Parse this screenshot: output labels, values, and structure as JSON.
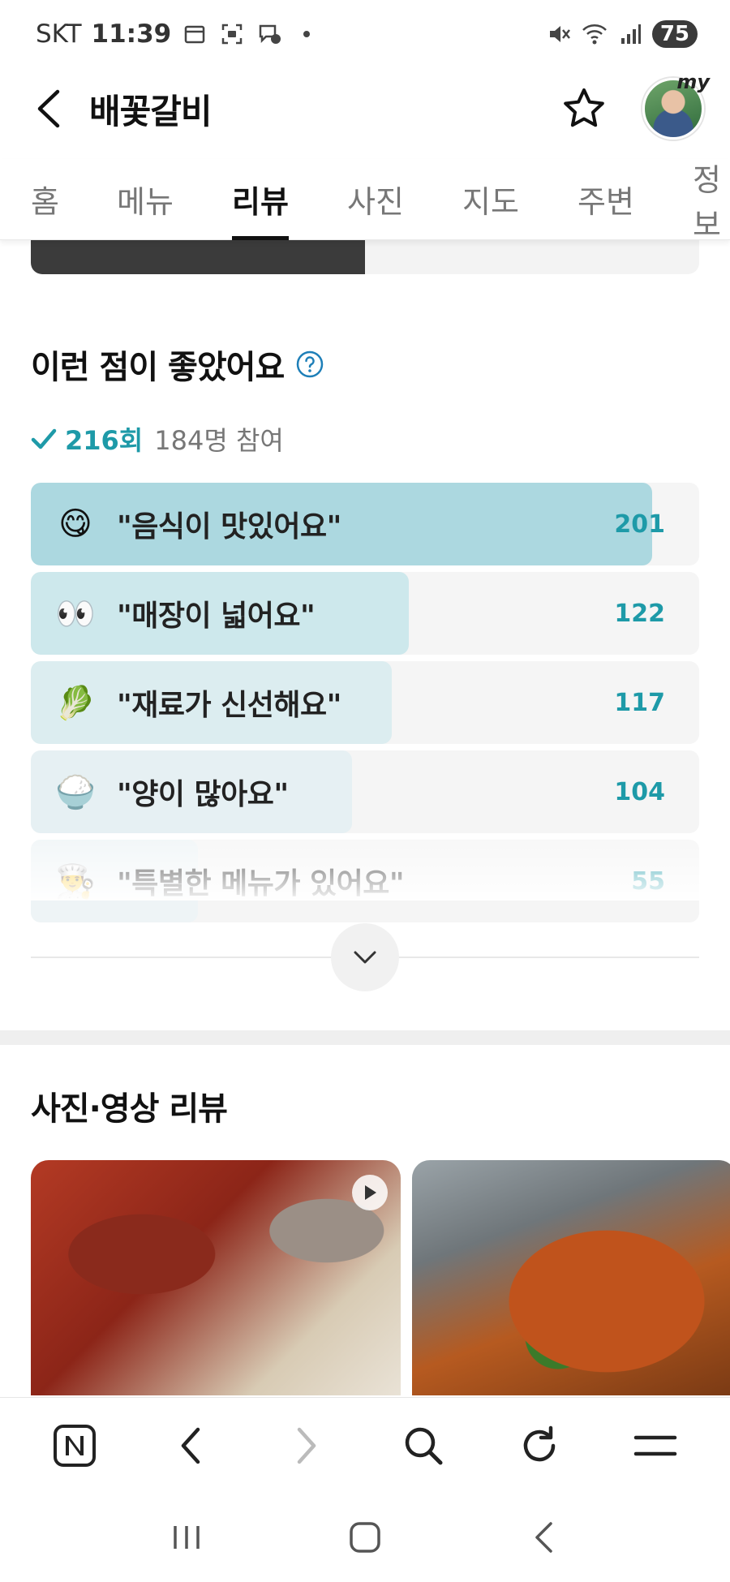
{
  "status_bar": {
    "carrier": "SKT",
    "time": "11:39",
    "battery": "75"
  },
  "header": {
    "title": "배꽃갈비"
  },
  "avatar_badge": "my",
  "tabs": [
    {
      "label": "홈"
    },
    {
      "label": "메뉴"
    },
    {
      "label": "리뷰",
      "active": true
    },
    {
      "label": "사진"
    },
    {
      "label": "지도"
    },
    {
      "label": "주변"
    },
    {
      "label": "정보"
    }
  ],
  "keywords_section": {
    "title": "이런 점이 좋았어요",
    "total_count": "216회",
    "participants": "184명 참여",
    "items": [
      {
        "emoji": "😋",
        "label": "\"음식이 맛있어요\"",
        "count": "201",
        "fraction": 0.93,
        "color": "#acd8e0"
      },
      {
        "emoji": "👀",
        "label": "\"매장이 넓어요\"",
        "count": "122",
        "fraction": 0.565,
        "color": "#cde8ec"
      },
      {
        "emoji": "🥬",
        "label": "\"재료가 신선해요\"",
        "count": "117",
        "fraction": 0.54,
        "color": "#dcedf0"
      },
      {
        "emoji": "🍚",
        "label": "\"양이 많아요\"",
        "count": "104",
        "fraction": 0.48,
        "color": "#e6f0f3"
      },
      {
        "emoji": "👨‍🍳",
        "label": "\"특별한 메뉴가 있어요\"",
        "count": "55",
        "fraction": 0.25,
        "color": "#eef4f6"
      }
    ]
  },
  "media_section": {
    "title": "사진·영상 리뷰"
  }
}
